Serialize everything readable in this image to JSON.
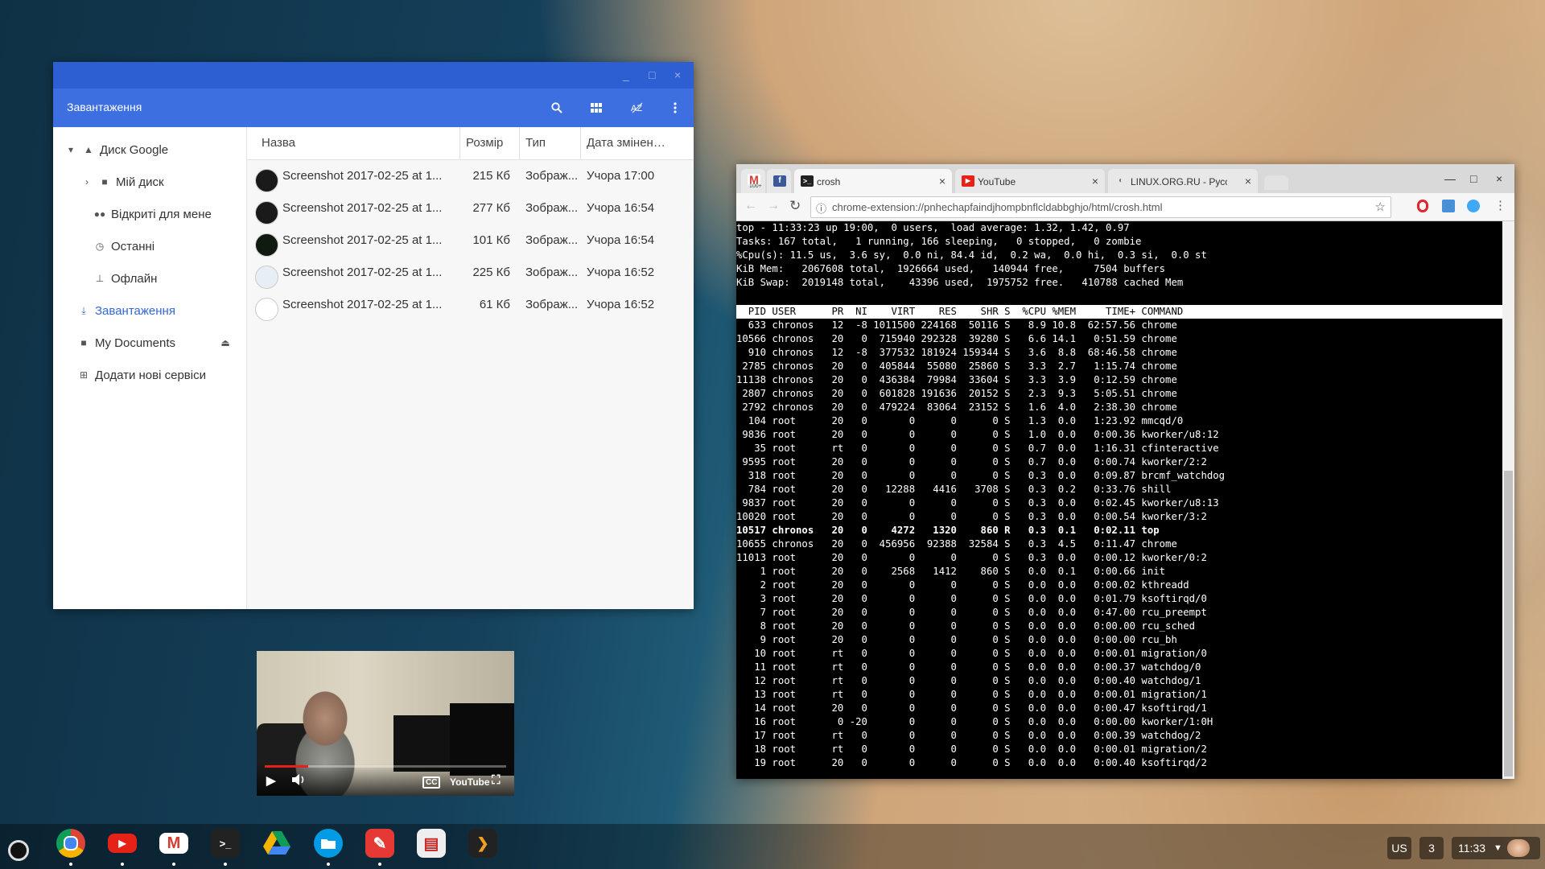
{
  "files": {
    "window_controls": {
      "minimize": "_",
      "maximize": "□",
      "close": "×"
    },
    "title": "Завантаження",
    "nav": {
      "drive": "Диск Google",
      "my_drive": "Мій диск",
      "shared": "Відкриті для мене",
      "recent": "Останні",
      "offline": "Офлайн",
      "downloads": "Завантаження",
      "my_documents": "My Documents",
      "add_services": "Додати нові сервіси"
    },
    "columns": {
      "name": "Назва",
      "size": "Розмір",
      "type": "Тип",
      "date": "Дата змінен…"
    },
    "rows": [
      {
        "name": "Screenshot 2017-02-25 at 1...",
        "size": "215 Кб",
        "type": "Зображ...",
        "date": "Учора 17:00",
        "thumb": "#1a1a1a"
      },
      {
        "name": "Screenshot 2017-02-25 at 1...",
        "size": "277 Кб",
        "type": "Зображ...",
        "date": "Учора 16:54",
        "thumb": "#1a1a1a"
      },
      {
        "name": "Screenshot 2017-02-25 at 1...",
        "size": "101 Кб",
        "type": "Зображ...",
        "date": "Учора 16:54",
        "thumb": "#111a11"
      },
      {
        "name": "Screenshot 2017-02-25 at 1...",
        "size": "225 Кб",
        "type": "Зображ...",
        "date": "Учора 16:52",
        "thumb": "#e8eef6"
      },
      {
        "name": "Screenshot 2017-02-25 at 1...",
        "size": "61 Кб",
        "type": "Зображ...",
        "date": "Учора 16:52",
        "thumb": "#ffffff"
      }
    ]
  },
  "video": {
    "progress": 0.18
  },
  "browser": {
    "tabs": {
      "gmail_badge": "100+",
      "crosh": "crosh",
      "youtube": "YouTube",
      "linuxorg": "LINUX.ORG.RU - Русская"
    },
    "url": "chrome-extension://pnhechapfaindjhompbnflcldabbghjo/html/crosh.html"
  },
  "terminal": {
    "summary": [
      "top - 11:33:23 up 19:00,  0 users,  load average: 1.32, 1.42, 0.97",
      "Tasks: 167 total,   1 running, 166 sleeping,   0 stopped,   0 zombie",
      "%Cpu(s): 11.5 us,  3.6 sy,  0.0 ni, 84.4 id,  0.2 wa,  0.0 hi,  0.3 si,  0.0 st",
      "KiB Mem:   2067608 total,  1926664 used,   140944 free,     7504 buffers",
      "KiB Swap:  2019148 total,    43396 used,  1975752 free.   410788 cached Mem"
    ],
    "header": "  PID USER      PR  NI    VIRT    RES    SHR S  %CPU %MEM     TIME+ COMMAND",
    "rows": [
      "  633 chronos   12  -8 1011500 224168  50116 S   8.9 10.8  62:57.56 chrome",
      "10566 chronos   20   0  715940 292328  39280 S   6.6 14.1   0:51.59 chrome",
      "  910 chronos   12  -8  377532 181924 159344 S   3.6  8.8  68:46.58 chrome",
      " 2785 chronos   20   0  405844  55080  25860 S   3.3  2.7   1:15.74 chrome",
      "11138 chronos   20   0  436384  79984  33604 S   3.3  3.9   0:12.59 chrome",
      " 2807 chronos   20   0  601828 191636  20152 S   2.3  9.3   5:05.51 chrome",
      " 2792 chronos   20   0  479224  83064  23152 S   1.6  4.0   2:38.30 chrome",
      "  104 root      20   0       0      0      0 S   1.3  0.0   1:23.92 mmcqd/0",
      " 9836 root      20   0       0      0      0 S   1.0  0.0   0:00.36 kworker/u8:12",
      "   35 root      rt   0       0      0      0 S   0.7  0.0   1:16.31 cfinteractive",
      " 9595 root      20   0       0      0      0 S   0.7  0.0   0:00.74 kworker/2:2",
      "  318 root      20   0       0      0      0 S   0.3  0.0   0:09.87 brcmf_watchdog",
      "  784 root      20   0   12288   4416   3708 S   0.3  0.2   0:33.76 shill",
      " 9837 root      20   0       0      0      0 S   0.3  0.0   0:02.45 kworker/u8:13",
      "10020 root      20   0       0      0      0 S   0.3  0.0   0:00.54 kworker/3:2",
      "10517 chronos   20   0    4272   1320    860 R   0.3  0.1   0:02.11 top",
      "10655 chronos   20   0  456956  92388  32584 S   0.3  4.5   0:11.47 chrome",
      "11013 root      20   0       0      0      0 S   0.3  0.0   0:00.12 kworker/0:2",
      "    1 root      20   0    2568   1412    860 S   0.0  0.1   0:00.66 init",
      "    2 root      20   0       0      0      0 S   0.0  0.0   0:00.02 kthreadd",
      "    3 root      20   0       0      0      0 S   0.0  0.0   0:01.79 ksoftirqd/0",
      "    7 root      20   0       0      0      0 S   0.0  0.0   0:47.00 rcu_preempt",
      "    8 root      20   0       0      0      0 S   0.0  0.0   0:00.00 rcu_sched",
      "    9 root      20   0       0      0      0 S   0.0  0.0   0:00.00 rcu_bh",
      "   10 root      rt   0       0      0      0 S   0.0  0.0   0:00.01 migration/0",
      "   11 root      rt   0       0      0      0 S   0.0  0.0   0:00.37 watchdog/0",
      "   12 root      rt   0       0      0      0 S   0.0  0.0   0:00.40 watchdog/1",
      "   13 root      rt   0       0      0      0 S   0.0  0.0   0:00.01 migration/1",
      "   14 root      20   0       0      0      0 S   0.0  0.0   0:00.47 ksoftirqd/1",
      "   16 root       0 -20       0      0      0 S   0.0  0.0   0:00.00 kworker/1:0H",
      "   17 root      rt   0       0      0      0 S   0.0  0.0   0:00.39 watchdog/2",
      "   18 root      rt   0       0      0      0 S   0.0  0.0   0:00.01 migration/2",
      "   19 root      20   0       0      0      0 S   0.0  0.0   0:00.40 ksoftirqd/2"
    ],
    "bold_row": 15
  },
  "tray": {
    "ime": "US",
    "notifications": "3",
    "time": "11:33"
  },
  "colors": {
    "files_titlebar": "#2d5fd3",
    "files_toolbar": "#3d6fe0",
    "accent": "#3367d6"
  }
}
